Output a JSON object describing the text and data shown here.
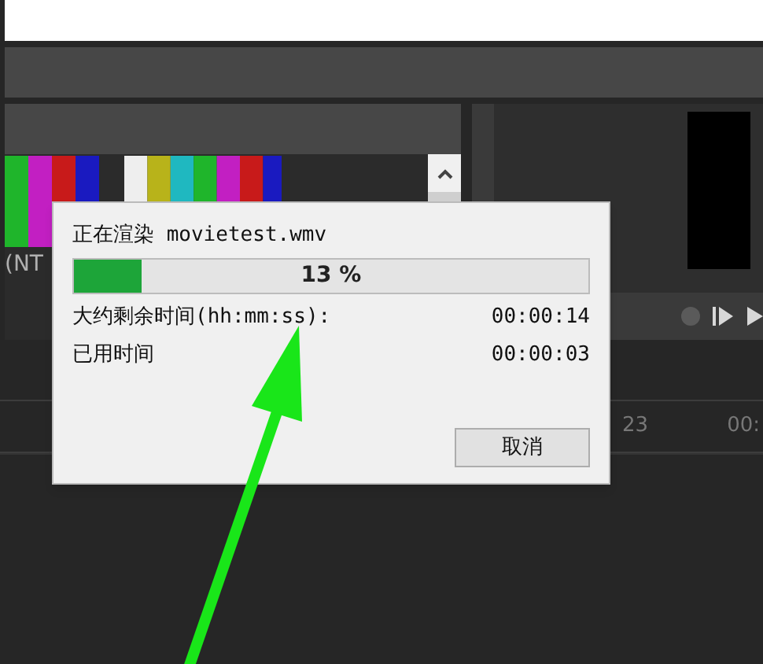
{
  "preview_panel": {
    "label": "(NT"
  },
  "timeline": {
    "ruler_labels": [
      "23",
      "00:"
    ]
  },
  "dialog": {
    "title": "正在渲染 movietest.wmv",
    "progress": {
      "level": 0.13,
      "text": "13 %"
    },
    "rows": [
      {
        "label": "大约剩余时间(hh:mm:ss):",
        "value": "00:00:14"
      },
      {
        "label": "已用时间",
        "value": "00:00:03"
      }
    ],
    "button": "取消"
  }
}
